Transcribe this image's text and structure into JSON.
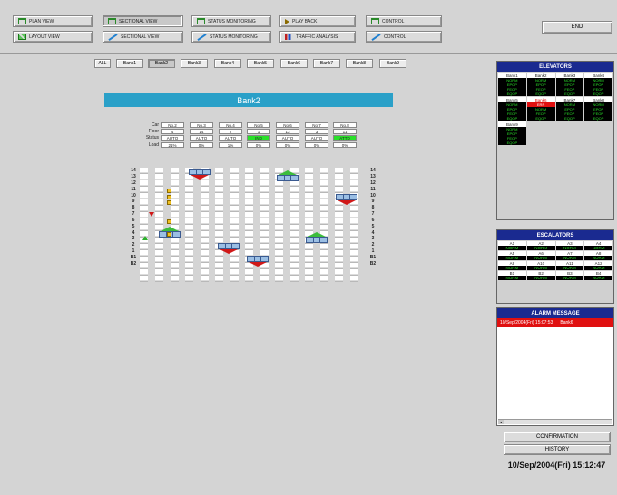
{
  "nav": {
    "row1": [
      {
        "label": "PLAN VIEW",
        "icon": "plan-icon"
      },
      {
        "label": "SECTIONAL VIEW",
        "icon": "plan-icon",
        "active": true
      },
      {
        "label": "STATUS MONITORING",
        "icon": "plan-icon"
      },
      {
        "label": "PLAY BACK",
        "icon": "play-icon"
      },
      {
        "label": "CONTROL",
        "icon": "plan-icon"
      }
    ],
    "row2": [
      {
        "label": "LAYOUT VIEW",
        "icon": "layout-icon"
      },
      {
        "label": "SECTIONAL VIEW",
        "icon": "pen-icon"
      },
      {
        "label": "STATUS MONITORING",
        "icon": "pen-icon"
      },
      {
        "label": "TRAFFIC ANALYSIS",
        "icon": "bar-chart-icon"
      },
      {
        "label": "CONTROL",
        "icon": "pen-icon"
      }
    ],
    "end_label": "END"
  },
  "bank_tabs": [
    "ALL",
    "Bank1",
    "Bank2",
    "Bank3",
    "Bank4",
    "Bank5",
    "Bank6",
    "Bank7",
    "Bank8",
    "Bank9"
  ],
  "bank_tabs_active": 2,
  "bank_title": "Bank2",
  "car_table": {
    "row_labels": [
      "Car",
      "Floor",
      "Status",
      "Load"
    ],
    "cars": [
      {
        "car": "No.2",
        "floor": "4",
        "status": "AUTO",
        "load": "21%"
      },
      {
        "car": "No.3",
        "floor": "14",
        "status": "AUTO",
        "load": "0%"
      },
      {
        "car": "No.4",
        "floor": "2",
        "status": "AUTO",
        "load": "1%"
      },
      {
        "car": "No.5",
        "floor": "1",
        "status": "IND",
        "load": "0%"
      },
      {
        "car": "No.6",
        "floor": "13",
        "status": "AUTO",
        "load": "0%"
      },
      {
        "car": "No.7",
        "floor": "3",
        "status": "AUTO",
        "load": "0%"
      },
      {
        "car": "No.8",
        "floor": "11",
        "status": "ATTD",
        "load": "0%"
      }
    ],
    "highlight_status": [
      "IND",
      "ATTD"
    ]
  },
  "floors": [
    "14",
    "13",
    "12",
    "11",
    "10",
    "9",
    "8",
    "7",
    "6",
    "5",
    "4",
    "3",
    "2",
    "1",
    "B1",
    "B2"
  ],
  "elevators": {
    "title": "ELEVATORS",
    "groups": [
      {
        "name": "Bank1",
        "status": [
          "NORM",
          "EPOP",
          "FEOP",
          "EQOP"
        ]
      },
      {
        "name": "Bank2",
        "status": [
          "NORM",
          "EPOP",
          "FEOP",
          "EQOP"
        ]
      },
      {
        "name": "Bank3",
        "status": [
          "NORM",
          "EPOP",
          "FEOP",
          "EQOP"
        ]
      },
      {
        "name": "Bank4",
        "status": [
          "NORM",
          "EPOP",
          "FEOP",
          "EQOP"
        ]
      },
      {
        "name": "Bank5",
        "status": [
          "NORM",
          "EPOP",
          "FEOP",
          "EQOP"
        ]
      },
      {
        "name": "Bank6",
        "status": [
          "ERR",
          "NORM",
          "FEOP",
          "EQOP"
        ],
        "error": true
      },
      {
        "name": "Bank7",
        "status": [
          "NORM",
          "EPOP",
          "FEOP",
          "EQOP"
        ]
      },
      {
        "name": "Bank8",
        "status": [
          "NORM",
          "EPOP",
          "FEOP",
          "EQOP"
        ]
      },
      {
        "name": "Bank9",
        "status": [
          "NORM",
          "EPOP",
          "FEOP",
          "EQOP"
        ]
      }
    ]
  },
  "escalators": {
    "title": "ESCALATORS",
    "items": [
      "A1",
      "A2",
      "A3",
      "A4",
      "A5",
      "A6",
      "A7",
      "A8",
      "A9",
      "A10",
      "A11",
      "A12",
      "B1",
      "B2",
      "B3",
      "B4"
    ],
    "status": "NORM"
  },
  "alarm": {
    "title": "ALARM MESSAGE",
    "entry_time": "10/Sep/2004(Fri) 15:07:53",
    "entry_source": "Bank6"
  },
  "buttons": {
    "confirmation": "CONFIRMATION",
    "history": "HISTORY"
  },
  "clock": "10/Sep/2004(Fri) 15:12:47"
}
